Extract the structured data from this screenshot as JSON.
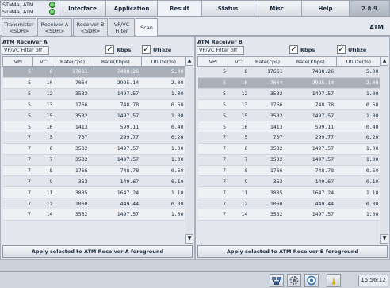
{
  "header": {
    "devices": [
      "STM4a, ATM",
      "STM4a, ATM"
    ],
    "tabs": [
      "Interface",
      "Application",
      "Result",
      "Status",
      "Misc.",
      "Help"
    ],
    "version": "2.8.9"
  },
  "subtabs": [
    {
      "top": "Transmitter",
      "bottom": "<SDH>"
    },
    {
      "top": "Receiver A",
      "bottom": "<SDH>"
    },
    {
      "top": "Receiver B",
      "bottom": "<SDH>"
    },
    {
      "top": "VP/VC",
      "bottom": "Filter"
    },
    {
      "top": "Scan",
      "bottom": ""
    }
  ],
  "atm_label": "ATM",
  "columns": [
    "VPI",
    "VCI",
    "Rate(cps)",
    "Rate(Kbps)",
    "Utilize(%)"
  ],
  "panel_a": {
    "title": "ATM Receiver A",
    "filter": "VP/VC Filter off",
    "kbps_label": "Kbps",
    "utilize_label": "Utilize",
    "kbps_checked": "✓",
    "utilize_checked": "✓",
    "selected_row": 0,
    "apply": "Apply selected to ATM Receiver A foreground",
    "rows": [
      [
        "5",
        "8",
        "17661",
        "7488.26",
        "5.00"
      ],
      [
        "5",
        "10",
        "7064",
        "2995.14",
        "2.00"
      ],
      [
        "5",
        "12",
        "3532",
        "1497.57",
        "1.00"
      ],
      [
        "5",
        "13",
        "1766",
        "748.78",
        "0.50"
      ],
      [
        "5",
        "15",
        "3532",
        "1497.57",
        "1.00"
      ],
      [
        "5",
        "16",
        "1413",
        "599.11",
        "0.40"
      ],
      [
        "7",
        "5",
        "707",
        "299.77",
        "0.20"
      ],
      [
        "7",
        "6",
        "3532",
        "1497.57",
        "1.00"
      ],
      [
        "7",
        "7",
        "3532",
        "1497.57",
        "1.00"
      ],
      [
        "7",
        "8",
        "1766",
        "748.78",
        "0.50"
      ],
      [
        "7",
        "9",
        "353",
        "149.67",
        "0.10"
      ],
      [
        "7",
        "11",
        "3885",
        "1647.24",
        "1.10"
      ],
      [
        "7",
        "12",
        "1060",
        "449.44",
        "0.30"
      ],
      [
        "7",
        "14",
        "3532",
        "1497.57",
        "1.00"
      ]
    ]
  },
  "panel_b": {
    "title": "ATM Receiver B",
    "filter": "VP/VC Filter off",
    "kbps_label": "Kbps",
    "utilize_label": "Utilize",
    "kbps_checked": "✓",
    "utilize_checked": "✓",
    "selected_row": 1,
    "apply": "Apply selected to ATM Receiver B foreground",
    "rows": [
      [
        "5",
        "8",
        "17661",
        "7488.26",
        "5.00"
      ],
      [
        "5",
        "10",
        "7064",
        "2995.14",
        "2.00"
      ],
      [
        "5",
        "12",
        "3532",
        "1497.57",
        "1.00"
      ],
      [
        "5",
        "13",
        "1766",
        "748.78",
        "0.50"
      ],
      [
        "5",
        "15",
        "3532",
        "1497.57",
        "1.00"
      ],
      [
        "5",
        "16",
        "1413",
        "599.11",
        "0.40"
      ],
      [
        "7",
        "5",
        "707",
        "299.77",
        "0.20"
      ],
      [
        "7",
        "6",
        "3532",
        "1497.57",
        "1.00"
      ],
      [
        "7",
        "7",
        "3532",
        "1497.57",
        "1.00"
      ],
      [
        "7",
        "8",
        "1766",
        "748.78",
        "0.50"
      ],
      [
        "7",
        "9",
        "353",
        "149.67",
        "0.10"
      ],
      [
        "7",
        "11",
        "3885",
        "1647.24",
        "1.10"
      ],
      [
        "7",
        "12",
        "1060",
        "449.44",
        "0.30"
      ],
      [
        "7",
        "14",
        "3532",
        "1497.57",
        "1.00"
      ]
    ]
  },
  "status": {
    "icons": [
      "network-icon",
      "gear-icon",
      "target-icon",
      "lock-icon"
    ],
    "time": "15:56:12"
  },
  "colors": {
    "selected_row": "#a9b0b9",
    "led_green": "#2a9a2a",
    "background": "#ccd2da"
  }
}
